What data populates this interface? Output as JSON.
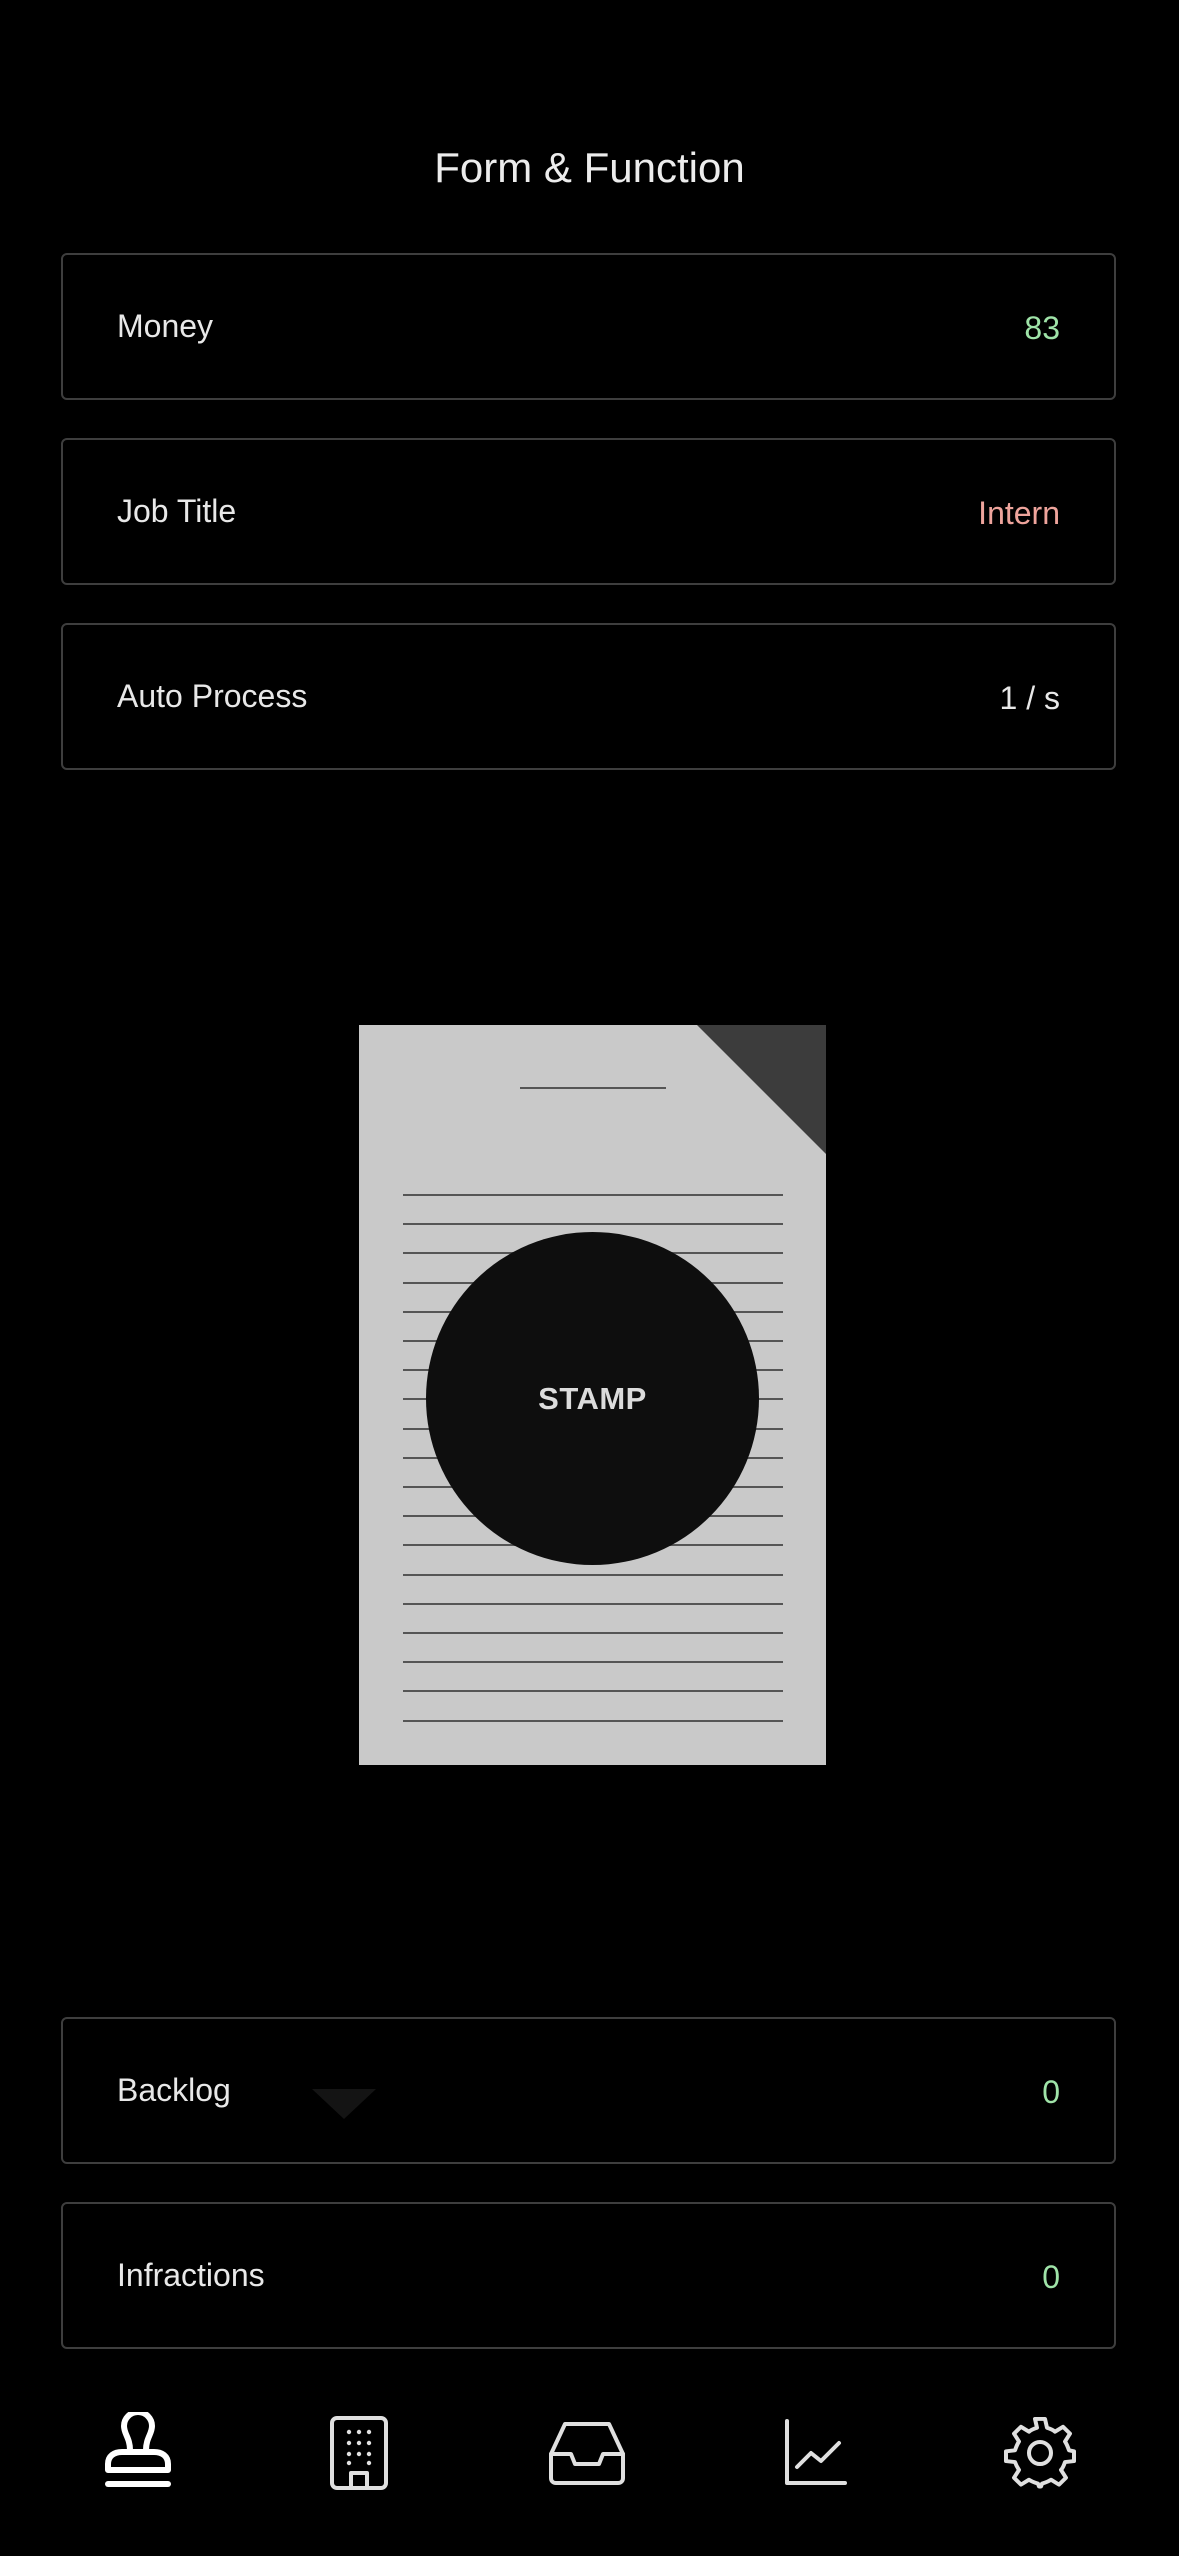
{
  "app": {
    "title": "Form & Function"
  },
  "stats": {
    "money": {
      "label": "Money",
      "value": "83"
    },
    "job_title": {
      "label": "Job Title",
      "value": "Intern"
    },
    "auto_process": {
      "label": "Auto Process",
      "value": "1 / s"
    }
  },
  "document": {
    "stamp_label": "STAMP"
  },
  "bottom_stats": {
    "backlog": {
      "label": "Backlog",
      "value": "0"
    },
    "infractions": {
      "label": "Infractions",
      "value": "0"
    }
  },
  "colors": {
    "background": "#000000",
    "money_value": "#9fe3a8",
    "job_title_value": "#eea49c",
    "neutral_value": "#e8e8e8",
    "count_value": "#9fe3a8",
    "paper": "#c9c9c9",
    "paper_fold": "#3c3c3c",
    "stamp": "#0e0e0e"
  },
  "tabs": [
    {
      "icon": "stamp-icon",
      "active": true
    },
    {
      "icon": "building-icon",
      "active": false
    },
    {
      "icon": "inbox-tray-icon",
      "active": false
    },
    {
      "icon": "line-chart-icon",
      "active": false
    },
    {
      "icon": "gear-icon",
      "active": false
    }
  ]
}
